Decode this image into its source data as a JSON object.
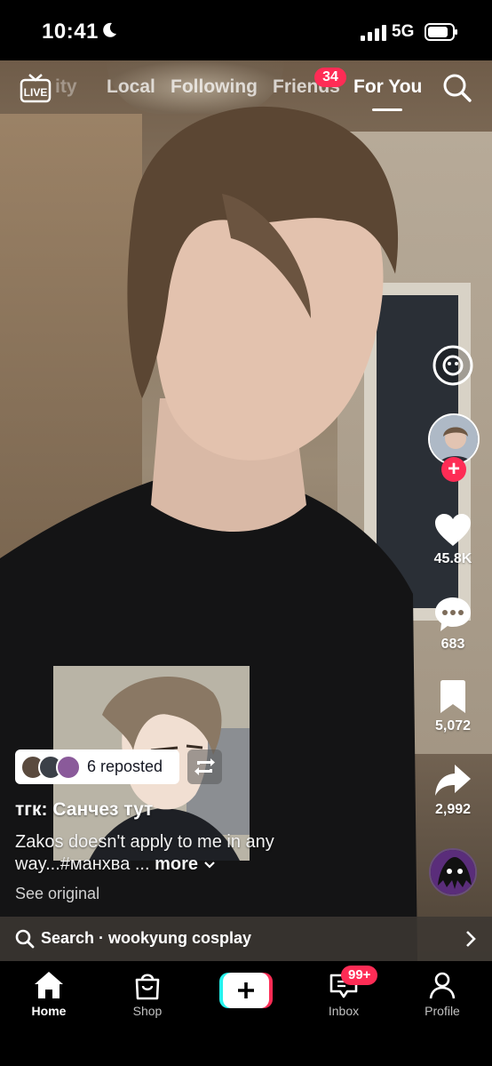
{
  "status_bar": {
    "time": "10:41",
    "network": "5G"
  },
  "top_nav": {
    "tabs": [
      {
        "label": "ity"
      },
      {
        "label": "Local"
      },
      {
        "label": "Following"
      },
      {
        "label": "Friends",
        "badge": "34"
      },
      {
        "label": "For You",
        "active": true
      }
    ]
  },
  "actions": {
    "likes": "45.8K",
    "comments": "683",
    "saves": "5,072",
    "shares": "2,992"
  },
  "post": {
    "repost_label": "6 reposted",
    "username": "тгк: Санчез тут",
    "caption": "Zakos doesn't apply to me in any way...#манхва ... ",
    "more": "more",
    "see_original": "See original"
  },
  "search_strip": {
    "label": "Search · wookyung cosplay"
  },
  "bottom_nav": {
    "home": "Home",
    "shop": "Shop",
    "inbox": "Inbox",
    "inbox_badge": "99+",
    "profile": "Profile"
  },
  "colors": {
    "accent": "#fe2c55",
    "cyan": "#25f4ee"
  }
}
